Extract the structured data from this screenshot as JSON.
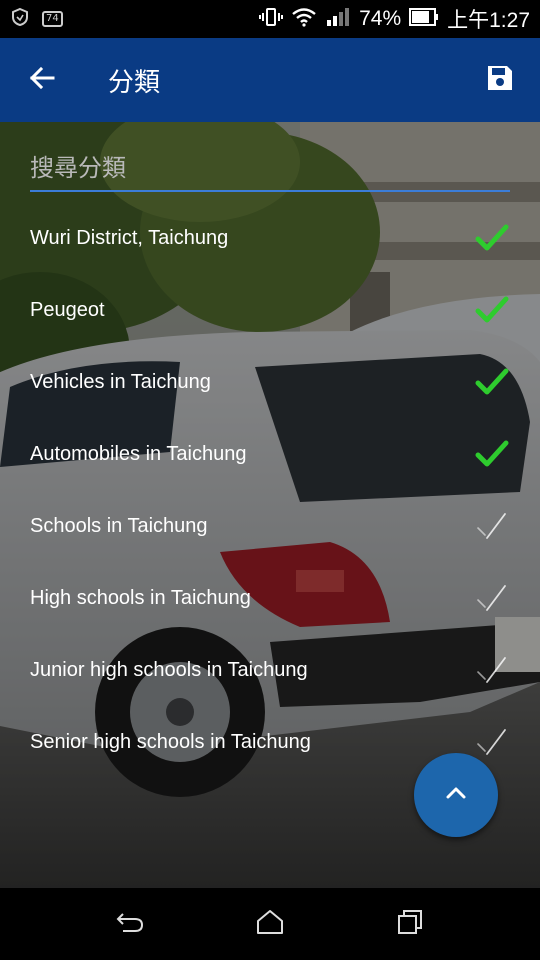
{
  "status_bar": {
    "notification_badge": "74",
    "battery_percent": "74%",
    "time": "上午1:27"
  },
  "app_bar": {
    "title": "分類",
    "back_icon": "arrow-back-icon",
    "save_icon": "save-icon"
  },
  "search": {
    "placeholder": "搜尋分類",
    "value": ""
  },
  "categories": [
    {
      "label": "Wuri District, Taichung",
      "checked": true
    },
    {
      "label": "Peugeot",
      "checked": true
    },
    {
      "label": "Vehicles in Taichung",
      "checked": true
    },
    {
      "label": "Automobiles in Taichung",
      "checked": true
    },
    {
      "label": "Schools in Taichung",
      "checked": false
    },
    {
      "label": "High schools in Taichung",
      "checked": false
    },
    {
      "label": "Junior high schools in Taichung",
      "checked": false
    },
    {
      "label": "Senior high schools in Taichung",
      "checked": false
    }
  ],
  "fab": {
    "icon": "chevron-up-icon"
  },
  "nav_bar": {
    "icons": [
      "back-icon",
      "home-icon",
      "recents-icon"
    ]
  },
  "colors": {
    "app_bar": "#0a3b84",
    "accent_underline": "#3b7dd8",
    "check_active": "#2ecc2e",
    "fab": "#1d66ac"
  }
}
